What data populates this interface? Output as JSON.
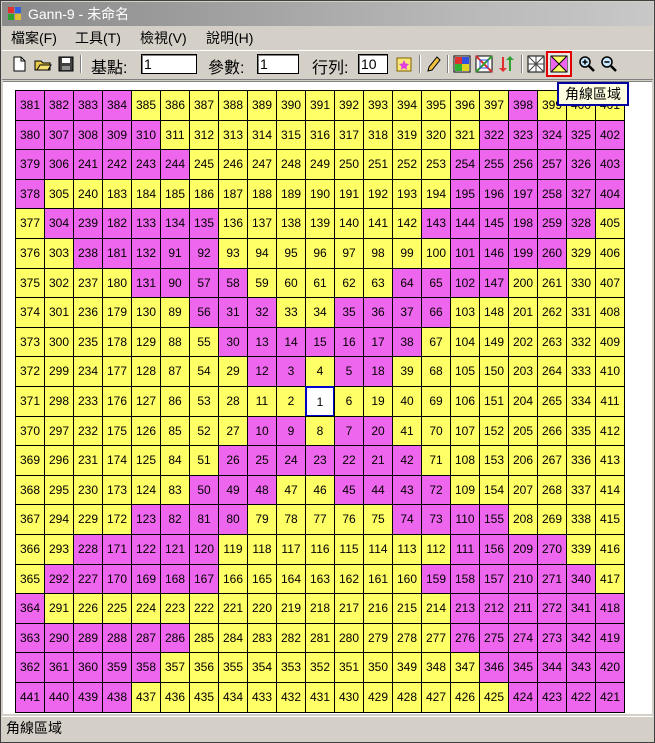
{
  "window": {
    "title": "Gann-9 - 未命名"
  },
  "menu": [
    "檔案(F)",
    "工具(T)",
    "檢視(V)",
    "說明(H)"
  ],
  "toolbar": {
    "base_label": "基點:",
    "base_value": "1",
    "param_label": "參數:",
    "param_value": "1",
    "rows_label": "行列:",
    "rows_value": "10"
  },
  "tooltip": "角線區域",
  "status": "角線區域",
  "colors": {
    "yellow": "#ffff66",
    "magenta": "#ee66ee",
    "center_border": "#0000cc"
  },
  "grid": {
    "center_value": 1,
    "rows": [
      {
        "values": [
          381,
          382,
          383,
          384,
          385,
          386,
          387,
          388,
          389,
          390,
          391,
          392,
          393,
          394,
          395,
          396,
          397,
          398,
          399,
          400,
          401
        ],
        "magenta": [
          0,
          1,
          2,
          3,
          17
        ]
      },
      {
        "values": [
          380,
          307,
          308,
          309,
          310,
          311,
          312,
          313,
          314,
          315,
          316,
          317,
          318,
          319,
          320,
          321,
          322,
          323,
          324,
          325,
          402
        ],
        "magenta": [
          0,
          1,
          2,
          3,
          4,
          16,
          17,
          18,
          19,
          20
        ]
      },
      {
        "values": [
          379,
          306,
          241,
          242,
          243,
          244,
          245,
          246,
          247,
          248,
          249,
          250,
          251,
          252,
          253,
          254,
          255,
          256,
          257,
          326,
          403
        ],
        "magenta": [
          0,
          1,
          2,
          3,
          4,
          5,
          15,
          16,
          17,
          18,
          19,
          20
        ]
      },
      {
        "values": [
          378,
          305,
          240,
          183,
          184,
          185,
          186,
          187,
          188,
          189,
          190,
          191,
          192,
          193,
          194,
          195,
          196,
          197,
          258,
          327,
          404
        ],
        "magenta": [
          0,
          15,
          16,
          17,
          18,
          19,
          20
        ]
      },
      {
        "values": [
          377,
          304,
          239,
          182,
          133,
          134,
          135,
          136,
          137,
          138,
          139,
          140,
          141,
          142,
          143,
          144,
          145,
          198,
          259,
          328,
          405
        ],
        "magenta": [
          1,
          2,
          3,
          4,
          5,
          6,
          14,
          15,
          16,
          17,
          18,
          19
        ]
      },
      {
        "values": [
          376,
          303,
          238,
          181,
          132,
          91,
          92,
          93,
          94,
          95,
          96,
          97,
          98,
          99,
          100,
          101,
          146,
          199,
          260,
          329,
          406
        ],
        "magenta": [
          2,
          3,
          4,
          5,
          6,
          15,
          16,
          17,
          18
        ]
      },
      {
        "values": [
          375,
          302,
          237,
          180,
          131,
          90,
          57,
          58,
          59,
          60,
          61,
          62,
          63,
          64,
          65,
          102,
          147,
          200,
          261,
          330,
          407
        ],
        "magenta": [
          4,
          5,
          6,
          7,
          13,
          14,
          15,
          16
        ]
      },
      {
        "values": [
          374,
          301,
          236,
          179,
          130,
          89,
          56,
          31,
          32,
          33,
          34,
          35,
          36,
          37,
          66,
          103,
          148,
          201,
          262,
          331,
          408
        ],
        "magenta": [
          6,
          7,
          8,
          11,
          12,
          13,
          14
        ]
      },
      {
        "values": [
          373,
          300,
          235,
          178,
          129,
          88,
          55,
          30,
          13,
          14,
          15,
          16,
          17,
          38,
          67,
          104,
          149,
          202,
          263,
          332,
          409
        ],
        "magenta": [
          7,
          8,
          9,
          10,
          11,
          12,
          13
        ]
      },
      {
        "values": [
          372,
          299,
          234,
          177,
          128,
          87,
          54,
          29,
          12,
          3,
          4,
          5,
          18,
          39,
          68,
          105,
          150,
          203,
          264,
          333,
          410
        ],
        "magenta": [
          8,
          9,
          11,
          12
        ]
      },
      {
        "values": [
          371,
          298,
          233,
          176,
          127,
          86,
          53,
          28,
          11,
          2,
          1,
          6,
          19,
          40,
          69,
          106,
          151,
          204,
          265,
          334,
          411
        ],
        "magenta": []
      },
      {
        "values": [
          370,
          297,
          232,
          175,
          126,
          85,
          52,
          27,
          10,
          9,
          8,
          7,
          20,
          41,
          70,
          107,
          152,
          205,
          266,
          335,
          412
        ],
        "magenta": [
          8,
          9,
          11,
          12
        ]
      },
      {
        "values": [
          369,
          296,
          231,
          174,
          125,
          84,
          51,
          26,
          25,
          24,
          23,
          22,
          21,
          42,
          71,
          108,
          153,
          206,
          267,
          336,
          413
        ],
        "magenta": [
          7,
          8,
          9,
          10,
          11,
          12,
          13
        ]
      },
      {
        "values": [
          368,
          295,
          230,
          173,
          124,
          83,
          50,
          49,
          48,
          47,
          46,
          45,
          44,
          43,
          72,
          109,
          154,
          207,
          268,
          337,
          414
        ],
        "magenta": [
          6,
          7,
          8,
          11,
          12,
          13,
          14
        ]
      },
      {
        "values": [
          367,
          294,
          229,
          172,
          123,
          82,
          81,
          80,
          79,
          78,
          77,
          76,
          75,
          74,
          73,
          110,
          155,
          208,
          269,
          338,
          415
        ],
        "magenta": [
          4,
          5,
          6,
          7,
          13,
          14,
          15,
          16
        ]
      },
      {
        "values": [
          366,
          293,
          228,
          171,
          122,
          121,
          120,
          119,
          118,
          117,
          116,
          115,
          114,
          113,
          112,
          111,
          156,
          209,
          270,
          339,
          416
        ],
        "magenta": [
          2,
          3,
          4,
          5,
          6,
          15,
          16,
          17,
          18
        ]
      },
      {
        "values": [
          365,
          292,
          227,
          170,
          169,
          168,
          167,
          166,
          165,
          164,
          163,
          162,
          161,
          160,
          159,
          158,
          157,
          210,
          271,
          340,
          417
        ],
        "magenta": [
          1,
          2,
          3,
          4,
          5,
          6,
          14,
          15,
          16,
          17,
          18,
          19
        ]
      },
      {
        "values": [
          364,
          291,
          226,
          225,
          224,
          223,
          222,
          221,
          220,
          219,
          218,
          217,
          216,
          215,
          214,
          213,
          212,
          211,
          272,
          341,
          418
        ],
        "magenta": [
          0,
          15,
          16,
          17,
          18,
          19,
          20
        ]
      },
      {
        "values": [
          363,
          290,
          289,
          288,
          287,
          286,
          285,
          284,
          283,
          282,
          281,
          280,
          279,
          278,
          277,
          276,
          275,
          274,
          273,
          342,
          419
        ],
        "magenta": [
          0,
          1,
          2,
          3,
          4,
          5,
          15,
          16,
          17,
          18,
          19,
          20
        ]
      },
      {
        "values": [
          362,
          361,
          360,
          359,
          358,
          357,
          356,
          355,
          354,
          353,
          352,
          351,
          350,
          349,
          348,
          347,
          346,
          345,
          344,
          343,
          420
        ],
        "magenta": [
          0,
          1,
          2,
          3,
          4,
          16,
          17,
          18,
          19,
          20
        ]
      },
      {
        "values": [
          441,
          440,
          439,
          438,
          437,
          436,
          435,
          434,
          433,
          432,
          431,
          430,
          429,
          428,
          427,
          426,
          425,
          424,
          423,
          422,
          421
        ],
        "magenta": [
          0,
          1,
          2,
          3,
          17,
          18,
          19,
          20
        ]
      }
    ]
  }
}
